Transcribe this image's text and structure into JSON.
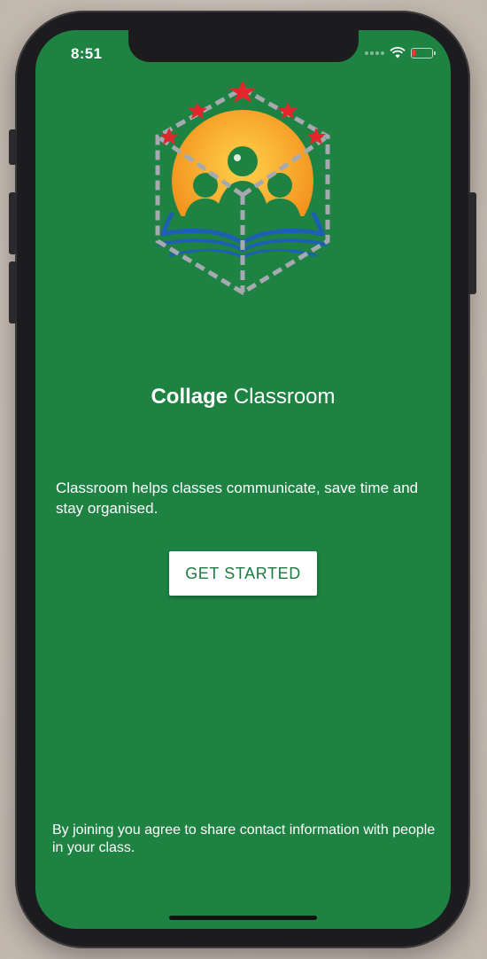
{
  "status_bar": {
    "time": "8:51",
    "battery_level": 0.15,
    "icons": [
      "signal-dots-icon",
      "wifi-icon",
      "battery-icon"
    ]
  },
  "logo": {
    "icon": "classroom-logo-icon",
    "colors": {
      "sun": "#f7a51c",
      "people": "#1d8242",
      "book": "#1e5fb4",
      "stars": "#e3262b",
      "hexagon": "#a6aab0"
    }
  },
  "app_title": {
    "bold": "Collage",
    "regular": "Classroom"
  },
  "tagline": "Classroom helps classes communicate, save time and stay organised.",
  "get_started_label": "GET STARTED",
  "disclaimer": "By joining you agree to share contact information with people in your class.",
  "theme": {
    "background": "#1d8242",
    "button_text": "#1d7a40",
    "button_background": "#ffffff"
  }
}
